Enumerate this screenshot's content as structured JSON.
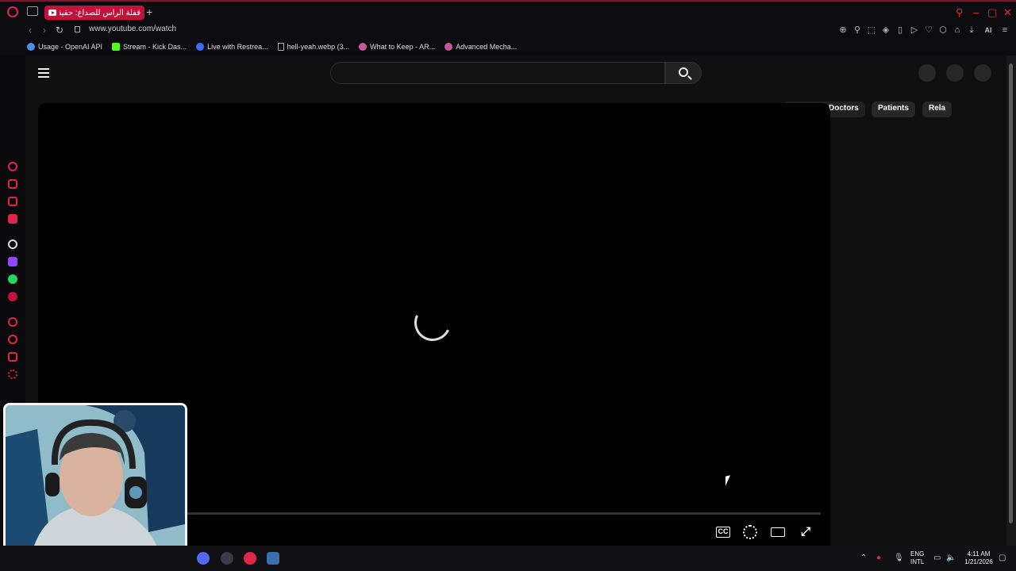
{
  "browser": {
    "tab_title": "قفلة الرأس للصداع: حقيقة أم",
    "url": "www.youtube.com/watch",
    "new_tab_symbol": "+",
    "bookmarks": [
      {
        "label": "Usage - OpenAI API",
        "color": "#4a90e2"
      },
      {
        "label": "Stream - Kick Das...",
        "color": "#53fc18"
      },
      {
        "label": "Live with Restrea...",
        "color": "#3b6cf5"
      },
      {
        "label": "hell-yeah.webp (3...",
        "color": "#888888"
      },
      {
        "label": "What to Keep - AR...",
        "color": "#c05a9a"
      },
      {
        "label": "Advanced Mecha...",
        "color": "#c05a9a"
      }
    ],
    "ai_label": "AI"
  },
  "youtube": {
    "chips": [
      "Doctors",
      "Patients",
      "Rela"
    ],
    "accent": "#ff0000"
  },
  "taskbar": {
    "lang_line1": "ENG",
    "lang_line2": "INTL",
    "time": "4:11 AM",
    "date": "1/21/2026"
  },
  "colors": {
    "opera_red": "#e0274a",
    "tab_active": "#c3123a",
    "page_bg": "#0f0f0f"
  }
}
